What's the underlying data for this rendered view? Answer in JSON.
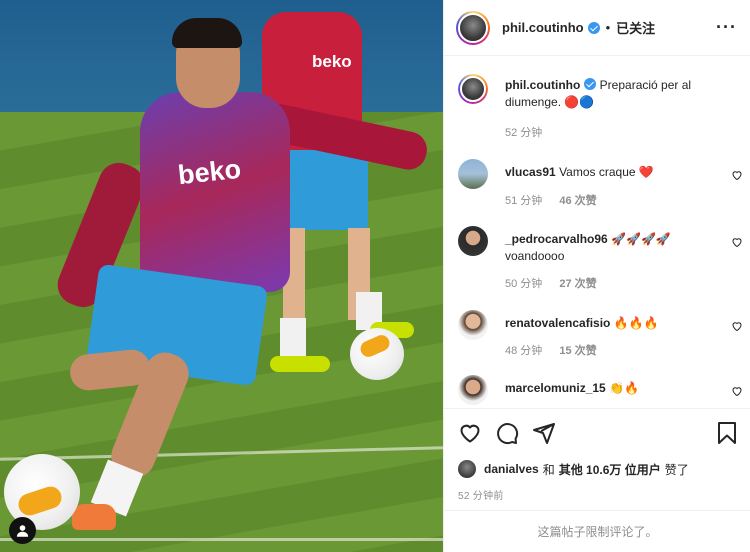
{
  "header": {
    "username": "phil.coutinho",
    "separator": "•",
    "follow_label": "已关注",
    "more_label": "···"
  },
  "post": {
    "username": "phil.coutinho",
    "caption": "Preparació per al diumenge. 🔴🔵",
    "time": "52 分钟"
  },
  "comments": [
    {
      "username": "vlucas91",
      "text": "Vamos craque ❤️",
      "time": "51 分钟",
      "likes": "46 次赞"
    },
    {
      "username": "_pedrocarvalho96",
      "text": "🚀🚀🚀🚀 voandoooo",
      "time": "50 分钟",
      "likes": "27 次赞"
    },
    {
      "username": "renatovalencafisio",
      "text": "🔥🔥🔥",
      "time": "48 分钟",
      "likes": "15 次赞"
    },
    {
      "username": "marcelomuniz_15",
      "text": "👏🔥",
      "time": "",
      "likes": ""
    }
  ],
  "likes_row": {
    "first_user": "danialves",
    "and": "和",
    "others": "其他 10.6万 位用户",
    "liked": "赞了"
  },
  "post_time": "52 分钟前",
  "comments_limited": "这篇帖子限制评论了。",
  "photo": {
    "front_shirt_logo": "beko",
    "back_shirt_logo": "beko"
  },
  "colors": {
    "verified_blue": "#3897f0",
    "text": "#262626",
    "secondary": "#8e8e8e",
    "heart_red": "#ed4956"
  },
  "icons": [
    "heart-icon",
    "comment-icon",
    "share-icon",
    "bookmark-icon",
    "verified-badge-icon",
    "more-icon",
    "user-tag-icon"
  ]
}
